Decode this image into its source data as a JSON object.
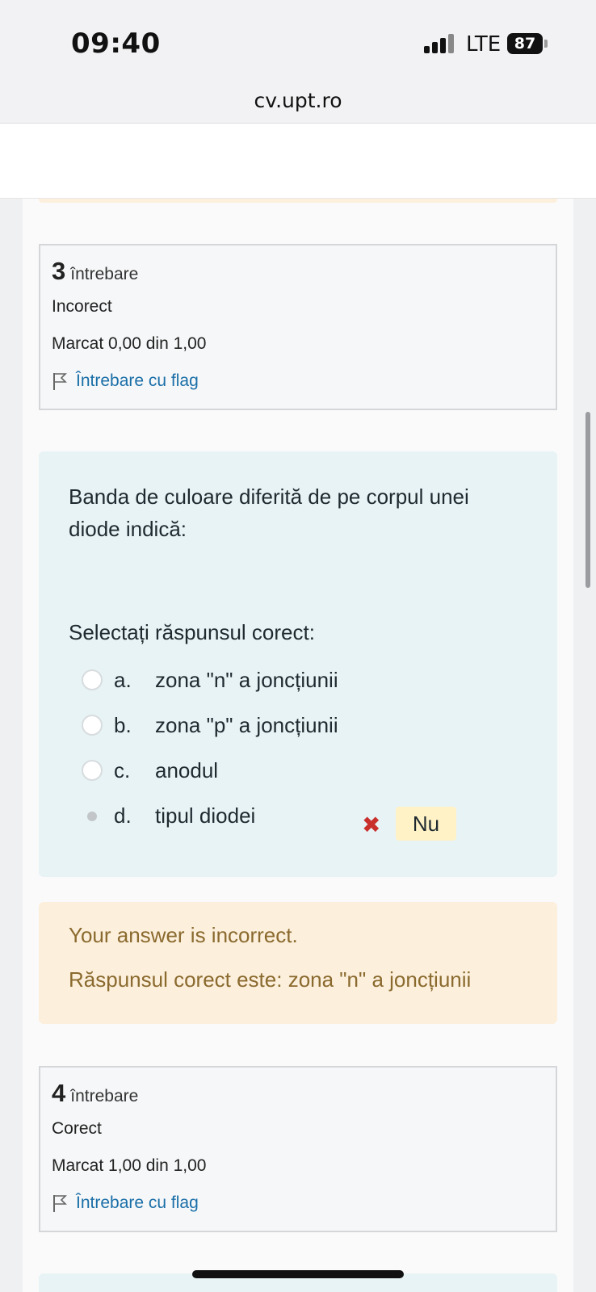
{
  "status_bar": {
    "time": "09:40",
    "network": "LTE",
    "battery": "87"
  },
  "browser": {
    "url": "cv.upt.ro"
  },
  "question3": {
    "number": "3",
    "label": "întrebare",
    "state": "Incorect",
    "grade": "Marcat 0,00 din 1,00",
    "flag_label": "Întrebare cu flag"
  },
  "question3_body": {
    "prompt": "Banda de culoare diferită de pe corpul unei diode indică:",
    "instruction": "Selectați răspunsul corect:",
    "answers": [
      {
        "letter": "a.",
        "text": "zona \"n\" a joncțiunii",
        "selected": false
      },
      {
        "letter": "b.",
        "text": "zona \"p\" a joncțiunii",
        "selected": false
      },
      {
        "letter": "c.",
        "text": "anodul",
        "selected": false
      },
      {
        "letter": "d.",
        "text": "tipul diodei",
        "selected": true,
        "mark": "Nu"
      }
    ]
  },
  "feedback": {
    "result": "Your answer is incorrect.",
    "correct_answer": "Răspunsul corect este: zona \"n\" a joncțiunii"
  },
  "question4": {
    "number": "4",
    "label": "întrebare",
    "state": "Corect",
    "grade": "Marcat 1,00 din 1,00",
    "flag_label": "Întrebare cu flag"
  },
  "colors": {
    "link": "#1a6fa8",
    "incorrect": "#c9302c",
    "feedback_bg": "#fcefdc",
    "question_bg": "#e7f3f5"
  }
}
